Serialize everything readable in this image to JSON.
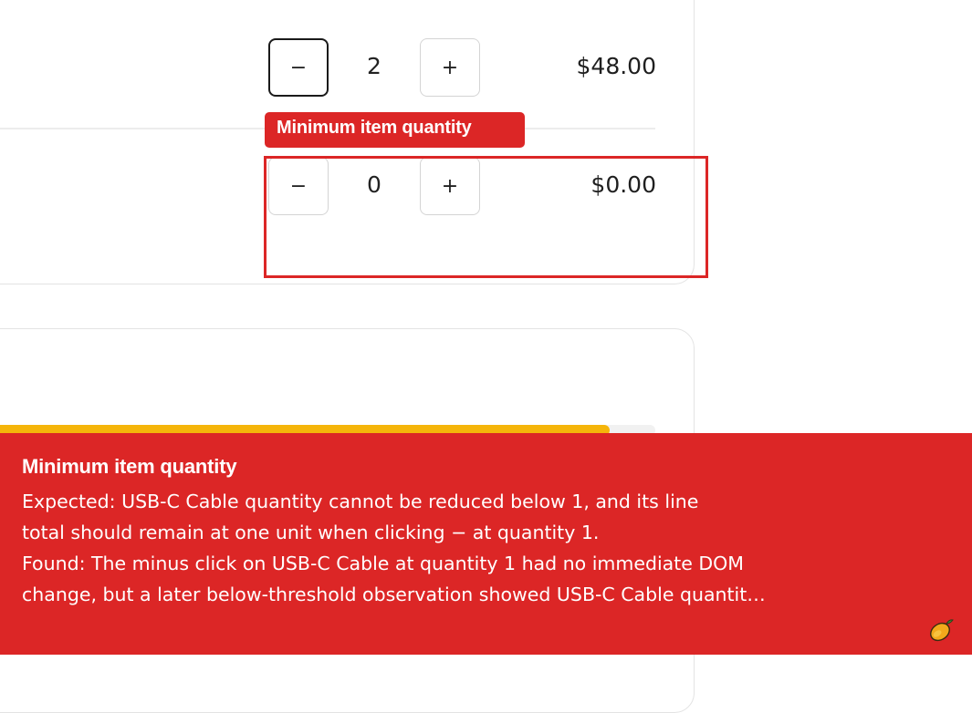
{
  "cart": {
    "rows": [
      {
        "decrement_label": "−",
        "quantity": "2",
        "increment_label": "+",
        "line_total": "$48.00"
      },
      {
        "decrement_label": "−",
        "quantity": "0",
        "increment_label": "+",
        "line_total": "$0.00"
      }
    ]
  },
  "annotation": {
    "tag_label": "Minimum item quantity"
  },
  "progress": {
    "fraction": 0.93,
    "fill_color": "#f5b50a"
  },
  "banner": {
    "title": "Minimum item quantity",
    "lines": [
      "Expected: USB-C Cable quantity cannot be reduced below 1, and its line",
      "total should remain at one unit when clicking − at quantity 1.",
      "Found: The minus click on USB-C Cable at quantity 1 had no immediate DOM",
      "change, but a later below-threshold observation showed USB-C Cable quantit…"
    ],
    "icon": "mango-icon",
    "color": "#dc2626"
  }
}
